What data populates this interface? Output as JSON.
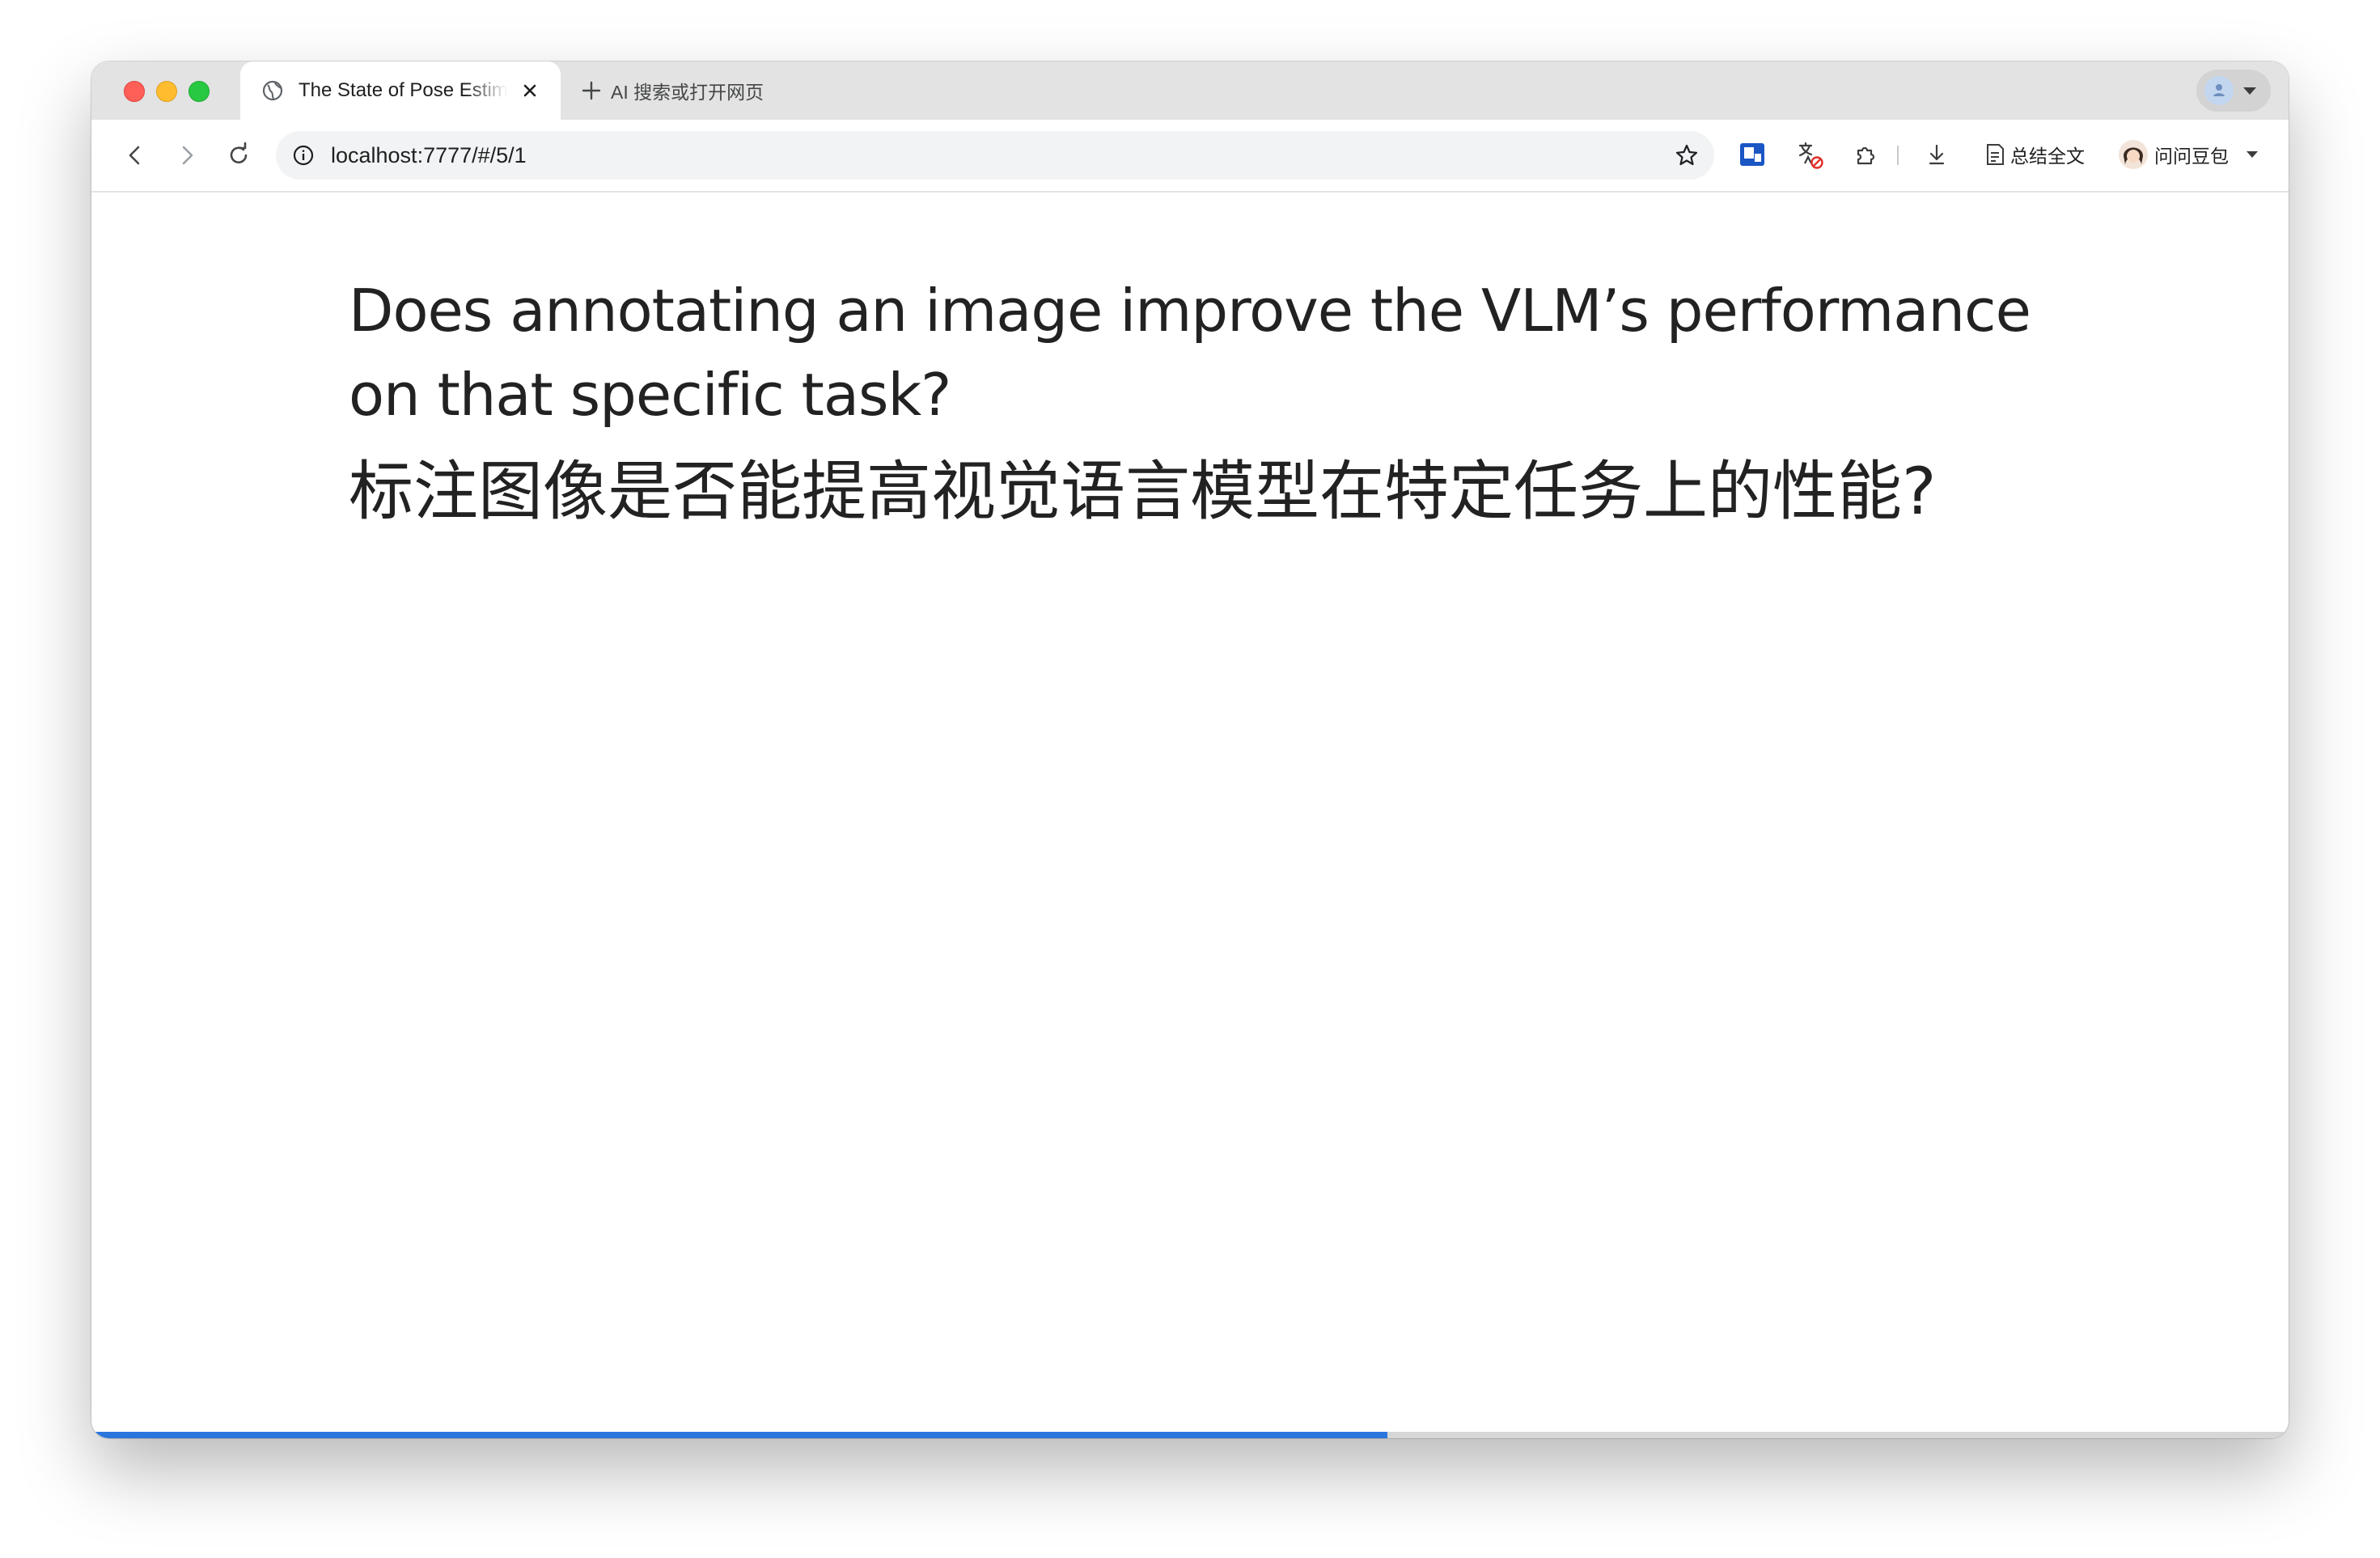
{
  "browser": {
    "tab": {
      "title": "The State of Pose Estimation",
      "favicon": "globe-icon"
    },
    "new_tab_label": "AI 搜索或打开网页",
    "url": "localhost:7777/#/5/1",
    "summary_label": "总结全文",
    "doubao_label": "问问豆包"
  },
  "slide": {
    "title_en": "Does annotating an image improve the VLM’s performance on that specific task?",
    "title_zh": "标注图像是否能提高视觉语言模型在特定任务上的性能?",
    "progress": 0.59
  },
  "colors": {
    "accent": "#2a76dd",
    "text": "#222222",
    "tabstrip": "#e3e3e3"
  }
}
